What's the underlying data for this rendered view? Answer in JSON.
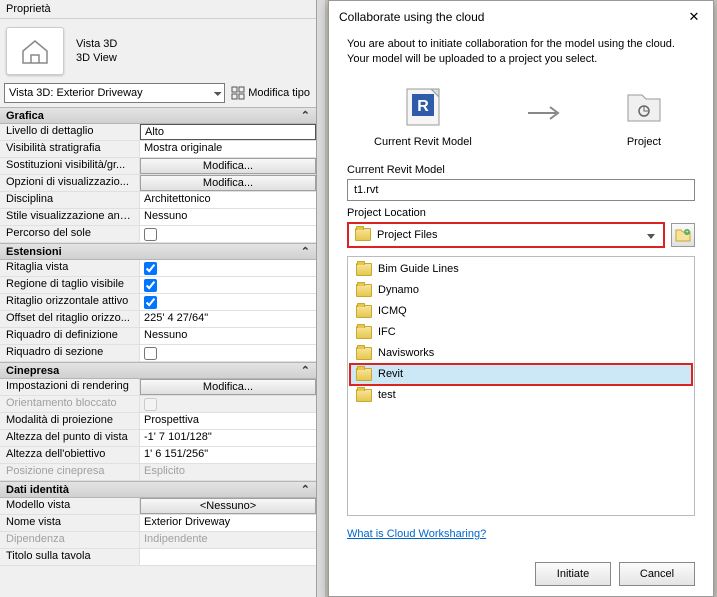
{
  "panel": {
    "title": "Proprietà",
    "thumb": {
      "line1": "Vista 3D",
      "line2": "3D View"
    },
    "view_selector": "Vista 3D: Exterior Driveway",
    "edit_type": "Modifica tipo"
  },
  "sections": {
    "grafica": "Grafica",
    "estensioni": "Estensioni",
    "cinepresa": "Cinepresa",
    "dati": "Dati identità"
  },
  "labels": {
    "livello": "Livello di dettaglio",
    "vis_strat": "Visibilità stratigrafia",
    "sost_vis": "Sostituzioni visibilità/gr...",
    "opz_vis": "Opzioni di visualizzazio...",
    "disciplina": "Disciplina",
    "stile_anal": "Stile visualizzazione anal...",
    "percorso_sole": "Percorso del sole",
    "ritaglia": "Ritaglia vista",
    "regione_vis": "Regione di taglio visibile",
    "ritaglio_orizz": "Ritaglio orizzontale attivo",
    "offset_ritaglio": "Offset del ritaglio orizzo...",
    "riquadro_def": "Riquadro di definizione",
    "riquadro_sez": "Riquadro di sezione",
    "imp_rendering": "Impostazioni di rendering",
    "orient_blocc": "Orientamento bloccato",
    "modalita": "Modalità di proiezione",
    "altezza_pv": "Altezza del punto di vista",
    "altezza_ob": "Altezza dell'obiettivo",
    "pos_cinepresa": "Posizione cinepresa",
    "modello_vista": "Modello vista",
    "nome_vista": "Nome vista",
    "dipendenza": "Dipendenza",
    "titolo_tavola": "Titolo sulla tavola"
  },
  "values": {
    "livello": "Alto",
    "vis_strat": "Mostra originale",
    "modifica": "Modifica...",
    "disciplina": "Architettonico",
    "stile_anal": "Nessuno",
    "offset_ritaglio": "225'  4 27/64\"",
    "riquadro_def": "Nessuno",
    "modalita": "Prospettiva",
    "altezza_pv": "-1'  7 101/128\"",
    "altezza_ob": "1'  6 151/256\"",
    "pos_cinepresa": "Esplicito",
    "modello_vista": "<Nessuno>",
    "nome_vista": "Exterior Driveway",
    "dipendenza": "Indipendente"
  },
  "dialog": {
    "title": "Collaborate using the cloud",
    "desc": "You are about to initiate collaboration for the model using the cloud. Your model will be uploaded to a project you select.",
    "icon1": "Current Revit Model",
    "icon2": "Project",
    "lbl_model": "Current Revit Model",
    "model_name": "t1.rvt",
    "lbl_location": "Project Location",
    "combo_value": "Project Files",
    "folders": [
      "Bim Guide Lines",
      "Dynamo",
      "ICMQ",
      "IFC",
      "Navisworks",
      "Revit",
      "test"
    ],
    "selected_index": 5,
    "link": "What is Cloud Worksharing?",
    "btn_initiate": "Initiate",
    "btn_cancel": "Cancel"
  }
}
